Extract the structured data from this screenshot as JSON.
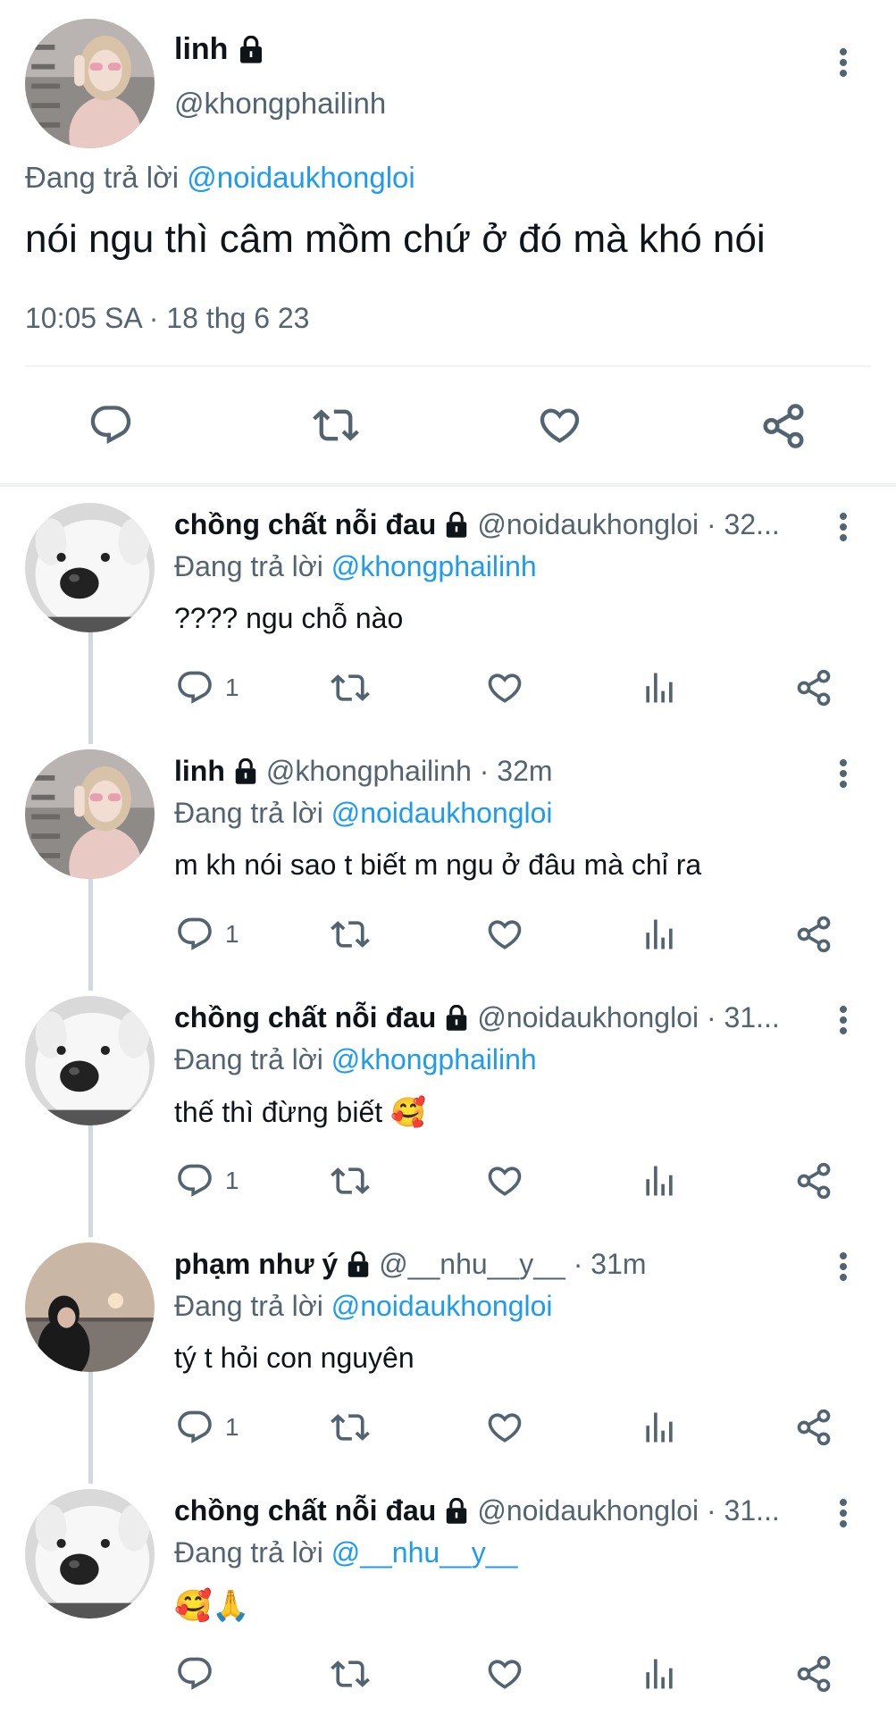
{
  "main_tweet": {
    "name": "linh",
    "handle": "@khongphailinh",
    "replying_prefix": "Đang trả lời",
    "replying_to": "@noidaukhongloi",
    "text": "nói ngu thì câm mồm chứ ở đó mà khó nói",
    "timestamp": "10:05 SA · 18 thg 6 23"
  },
  "replies": [
    {
      "name": "chồng chất nỗi đau",
      "handle": "@noidaukhongloi · 32...",
      "replying_prefix": "Đang trả lời",
      "replying_to": "@khongphailinh",
      "text": "???? ngu chỗ nào",
      "reply_count": "1"
    },
    {
      "name": "linh",
      "handle": "@khongphailinh · 32m",
      "replying_prefix": "Đang trả lời",
      "replying_to": "@noidaukhongloi",
      "text": "m kh nói sao t biết m ngu ở đâu mà chỉ ra",
      "reply_count": "1"
    },
    {
      "name": "chồng chất nỗi đau",
      "handle": "@noidaukhongloi · 31...",
      "replying_prefix": "Đang trả lời",
      "replying_to": "@khongphailinh",
      "text": "thế thì đừng biết 🥰",
      "reply_count": "1"
    },
    {
      "name": "phạm như ý",
      "handle": "@__nhu__y__ · 31m",
      "replying_prefix": "Đang trả lời",
      "replying_to": "@noidaukhongloi",
      "text": "tý t hỏi con nguyên",
      "reply_count": "1"
    },
    {
      "name": "chồng chất nỗi đau",
      "handle": "@noidaukhongloi · 31...",
      "replying_prefix": "Đang trả lời",
      "replying_to": "@__nhu__y__",
      "text": "🥰🙏",
      "reply_count": ""
    }
  ],
  "colors": {
    "link": "#1d9bf0",
    "secondary_text": "#536471",
    "divider": "#eff3f4",
    "thread_line": "#cfd9de"
  },
  "icons": [
    "lock-icon",
    "more-icon",
    "reply-icon",
    "retweet-icon",
    "like-icon",
    "views-icon",
    "share-icon"
  ]
}
